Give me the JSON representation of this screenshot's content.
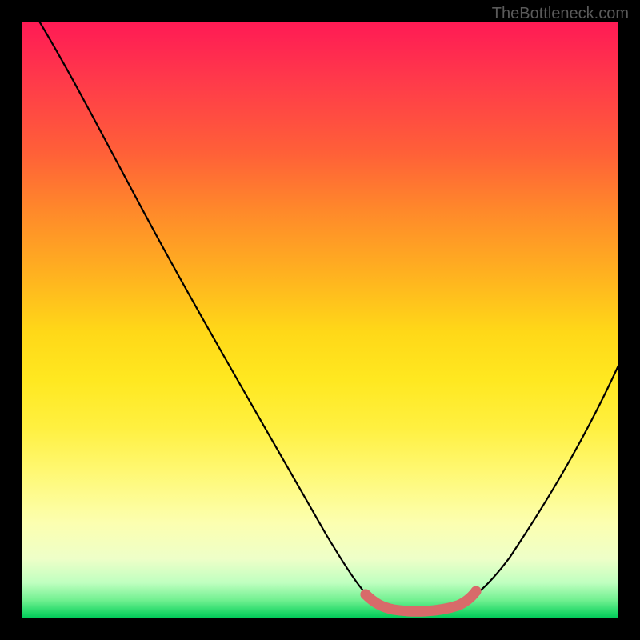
{
  "watermark": "TheBottleneck.com",
  "chart_data": {
    "type": "line",
    "title": "",
    "xlabel": "",
    "ylabel": "",
    "xlim": [
      0,
      100
    ],
    "ylim": [
      0,
      100
    ],
    "series": [
      {
        "name": "bottleneck-curve",
        "x": [
          0,
          5,
          10,
          15,
          20,
          25,
          30,
          35,
          40,
          45,
          50,
          55,
          57,
          60,
          65,
          70,
          75,
          80,
          85,
          90,
          95,
          100
        ],
        "y": [
          105,
          99,
          93,
          87,
          80,
          73,
          66,
          58,
          49,
          40,
          30,
          18,
          10,
          3,
          1,
          1,
          2,
          7,
          14,
          22,
          32,
          45
        ]
      },
      {
        "name": "optimal-range-highlight",
        "x": [
          57,
          60,
          65,
          70,
          75
        ],
        "y": [
          10,
          3,
          1,
          1,
          2
        ]
      }
    ],
    "gradient_background": {
      "top": "#ff1a55",
      "middle": "#ffe820",
      "bottom": "#00c858"
    },
    "highlight_color": "#d86a6a"
  }
}
